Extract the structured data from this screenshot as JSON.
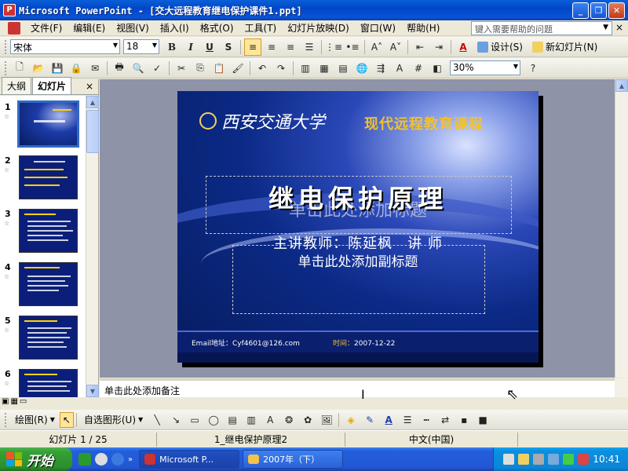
{
  "window": {
    "title": "Microsoft PowerPoint - [交大远程教育继电保护课件1.ppt]",
    "buttons": {
      "minimize": "_",
      "restore": "❐",
      "close": "✕"
    }
  },
  "menu": {
    "items": [
      "文件(F)",
      "编辑(E)",
      "视图(V)",
      "插入(I)",
      "格式(O)",
      "工具(T)",
      "幻灯片放映(D)",
      "窗口(W)",
      "帮助(H)"
    ],
    "help_placeholder": "键入需要帮助的问题",
    "close": "×"
  },
  "format_toolbar": {
    "font": "宋体",
    "size": "18",
    "bold": "B",
    "italic": "I",
    "underline": "U",
    "shadow": "S",
    "design_label": "设计(S)",
    "new_slide_label": "新幻灯片(N)"
  },
  "standard_toolbar": {
    "zoom": "30%"
  },
  "outline_tabs": {
    "outline": "大纲",
    "slides": "幻灯片",
    "close": "×"
  },
  "thumbnails": [
    {
      "num": "1"
    },
    {
      "num": "2"
    },
    {
      "num": "3"
    },
    {
      "num": "4"
    },
    {
      "num": "5"
    },
    {
      "num": "6"
    }
  ],
  "slide": {
    "university": "西安交通大学",
    "course": "现代远程教育课程",
    "title": "继电保护原理",
    "title_placeholder": "单击此处添加标题",
    "teacher": "主讲教师：陈延枫　讲 师",
    "subtitle_placeholder": "单击此处添加副标题",
    "email": "Email地址：Cyf4601@126.com",
    "date_label": "时间：",
    "date_value": "2007-12-22"
  },
  "notes": {
    "placeholder": "单击此处添加备注"
  },
  "draw_toolbar": {
    "draw_label": "绘图(R)",
    "autoshapes_label": "自选图形(U)"
  },
  "status": {
    "slide_pos": "幻灯片 1 / 25",
    "design": "1_继电保护原理2",
    "language": "中文(中国)"
  },
  "taskbar": {
    "start": "开始",
    "tasks": [
      "Microsoft P...",
      "2007年（下）"
    ],
    "clock": "10:41"
  },
  "colors": {
    "accent": "#0a5fd8",
    "slide_bg": "#0b2a86",
    "course_gold": "#f2c12e"
  }
}
